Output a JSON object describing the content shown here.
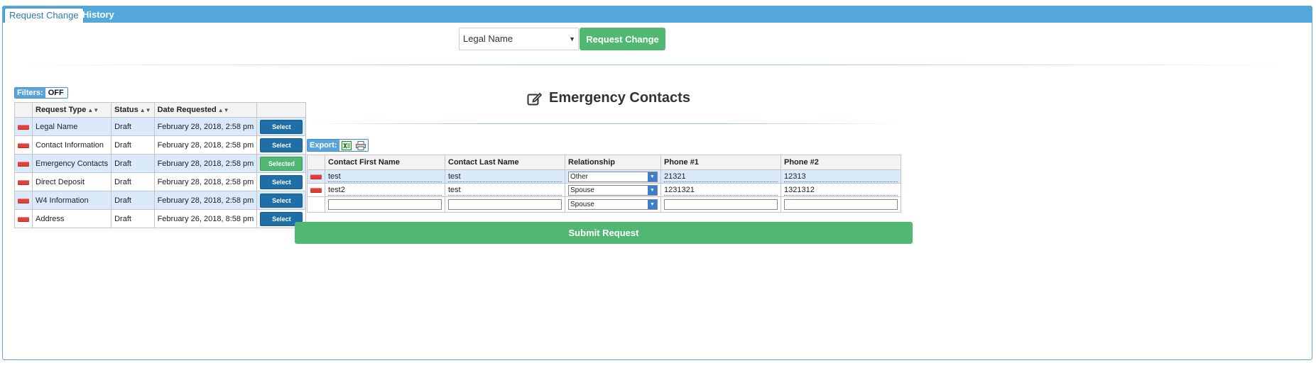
{
  "tabs": [
    {
      "label": "Request Change",
      "active": true
    },
    {
      "label": "History",
      "active": false
    }
  ],
  "request_bar": {
    "selected_type": "Legal Name",
    "request_button": "Request Change"
  },
  "filters": {
    "label": "Filters:",
    "state": "OFF"
  },
  "requests_table": {
    "headers": [
      "Request Type",
      "Status",
      "Date Requested"
    ],
    "rows": [
      {
        "type": "Legal Name",
        "status": "Draft",
        "date": "February 28, 2018, 2:58 pm",
        "action": "Select"
      },
      {
        "type": "Contact Information",
        "status": "Draft",
        "date": "February 28, 2018, 2:58 pm",
        "action": "Select"
      },
      {
        "type": "Emergency Contacts",
        "status": "Draft",
        "date": "February 28, 2018, 2:58 pm",
        "action": "Selected"
      },
      {
        "type": "Direct Deposit",
        "status": "Draft",
        "date": "February 28, 2018, 2:58 pm",
        "action": "Select"
      },
      {
        "type": "W4 Information",
        "status": "Draft",
        "date": "February 28, 2018, 2:58 pm",
        "action": "Select"
      },
      {
        "type": "Address",
        "status": "Draft",
        "date": "February 26, 2018, 8:58 pm",
        "action": "Select"
      }
    ]
  },
  "section": {
    "title": "Emergency Contacts"
  },
  "export": {
    "label": "Export:"
  },
  "contacts_table": {
    "headers": [
      "Contact First Name",
      "Contact Last Name",
      "Relationship",
      "Phone #1",
      "Phone #2"
    ],
    "rows": [
      {
        "first": "test",
        "last": "test",
        "relationship": "Other",
        "phone1": "21321",
        "phone2": "12313"
      },
      {
        "first": "test2",
        "last": "test",
        "relationship": "Spouse",
        "phone1": "1231321",
        "phone2": "1321312"
      }
    ],
    "new_row": {
      "relationship": "Spouse"
    }
  },
  "submit_label": "Submit Request",
  "colors": {
    "tab_bar": "#55a8dc",
    "green": "#51b874",
    "blue_button": "#1e6ea8",
    "highlight_row": "#dbeafb"
  }
}
